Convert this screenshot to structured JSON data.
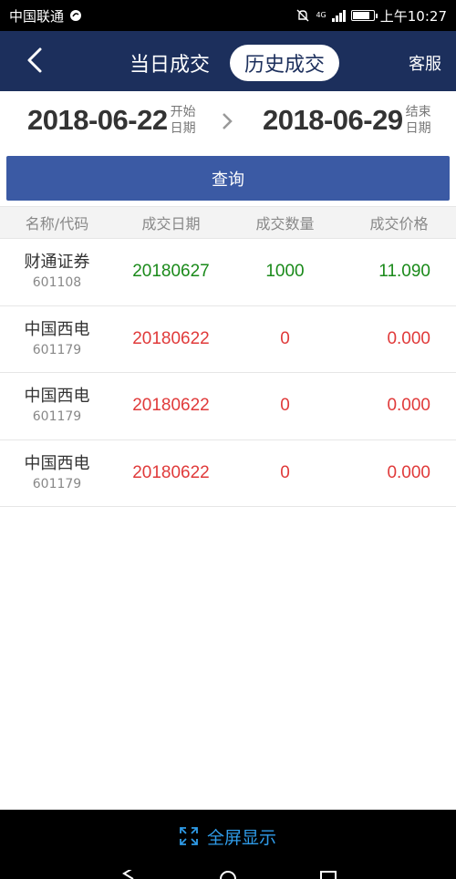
{
  "status_bar": {
    "carrier": "中国联通",
    "network": "4G",
    "time": "上午10:27"
  },
  "header": {
    "tabs": [
      {
        "label": "当日成交",
        "active": false
      },
      {
        "label": "历史成交",
        "active": true
      }
    ],
    "service_label": "客服"
  },
  "date_range": {
    "start": {
      "value": "2018-06-22",
      "label_line1": "开始",
      "label_line2": "日期"
    },
    "end": {
      "value": "2018-06-29",
      "label_line1": "结束",
      "label_line2": "日期"
    }
  },
  "query_button": "查询",
  "table": {
    "columns": [
      "名称/代码",
      "成交日期",
      "成交数量",
      "成交价格"
    ],
    "rows": [
      {
        "name": "财通证券",
        "code": "601108",
        "date": "20180627",
        "quantity": "1000",
        "price": "11.090",
        "color": "#1a8a1a"
      },
      {
        "name": "中国西电",
        "code": "601179",
        "date": "20180622",
        "quantity": "0",
        "price": "0.000",
        "color": "#e03a3a"
      },
      {
        "name": "中国西电",
        "code": "601179",
        "date": "20180622",
        "quantity": "0",
        "price": "0.000",
        "color": "#e03a3a"
      },
      {
        "name": "中国西电",
        "code": "601179",
        "date": "20180622",
        "quantity": "0",
        "price": "0.000",
        "color": "#e03a3a"
      }
    ]
  },
  "bottom_bar": {
    "fullscreen_label": "全屏显示",
    "accent_color": "#2f9be8"
  },
  "theme": {
    "header_bg": "#1c2f5c",
    "button_bg": "#3b5aa4"
  }
}
